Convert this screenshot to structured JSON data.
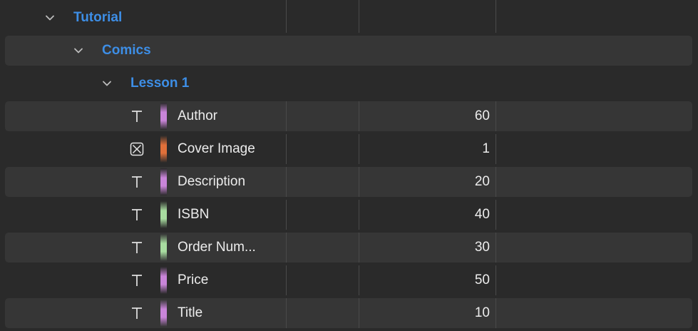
{
  "tree": {
    "group": {
      "label": "Tutorial",
      "expanded": true,
      "icon": "chevron-down-icon"
    },
    "subgroup": {
      "label": "Comics",
      "expanded": true,
      "icon": "chevron-down-icon"
    },
    "lesson": {
      "label": "Lesson 1",
      "expanded": true,
      "icon": "chevron-down-icon"
    },
    "fields": [
      {
        "type_icon": "text-type-icon",
        "color": "#c985d9",
        "name": "Author",
        "value": "60"
      },
      {
        "type_icon": "image-type-icon",
        "color": "#e0703a",
        "name": "Cover Image",
        "value": "1"
      },
      {
        "type_icon": "text-type-icon",
        "color": "#c985d9",
        "name": "Description",
        "value": "20"
      },
      {
        "type_icon": "text-type-icon",
        "color": "#a8dca0",
        "name": "ISBN",
        "value": "40"
      },
      {
        "type_icon": "text-type-icon",
        "color": "#a8dca0",
        "name": "Order Num...",
        "value": "30"
      },
      {
        "type_icon": "text-type-icon",
        "color": "#c985d9",
        "name": "Price",
        "value": "50"
      },
      {
        "type_icon": "text-type-icon",
        "color": "#c985d9",
        "name": "Title",
        "value": "10"
      }
    ]
  },
  "colors": {
    "background": "#2a2a2a",
    "stripe": "#363636",
    "accent": "#3d8ee6",
    "text": "#ececec",
    "divider": "#4a4a4a"
  }
}
